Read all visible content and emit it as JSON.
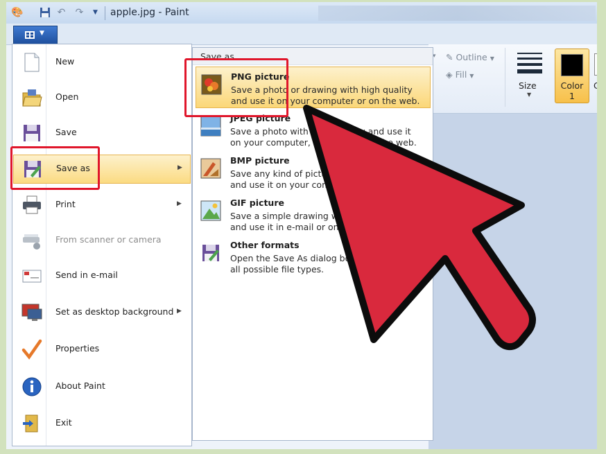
{
  "window": {
    "title": "apple.jpg - Paint"
  },
  "ribbon": {
    "outline_label": "Outline",
    "fill_label": "Fill",
    "size_label": "Size",
    "color1_label_line1": "Color",
    "color1_label_line2": "1",
    "color2_label_partial": "Co"
  },
  "app_menu": {
    "items": [
      {
        "label": "New",
        "icon": "new-page-icon"
      },
      {
        "label": "Open",
        "icon": "open-folder-icon"
      },
      {
        "label": "Save",
        "icon": "save-disk-icon"
      },
      {
        "label": "Save as",
        "icon": "save-as-icon",
        "highlighted": true,
        "submenu": true
      },
      {
        "label": "Print",
        "icon": "printer-icon",
        "submenu": true
      },
      {
        "label": "From scanner or camera",
        "icon": "scanner-icon",
        "disabled": true
      },
      {
        "label": "Send in e-mail",
        "icon": "email-icon"
      },
      {
        "label": "Set as desktop background",
        "icon": "desktop-background-icon",
        "submenu": true
      },
      {
        "label": "Properties",
        "icon": "checkmark-icon"
      },
      {
        "label": "About Paint",
        "icon": "info-icon"
      },
      {
        "label": "Exit",
        "icon": "exit-icon"
      }
    ]
  },
  "save_as_menu": {
    "heading": "Save as",
    "items": [
      {
        "title": "PNG picture",
        "line1": "Save a photo or drawing with high quality",
        "line2": "and use it on your computer or on the web.",
        "highlighted": true
      },
      {
        "title": "JPEG picture",
        "line1": "Save a photo with good quality and use it",
        "line2": "on your computer, in e-mail or on the web."
      },
      {
        "title": "BMP picture",
        "line1": "Save any kind of picture with high quality",
        "line2": "and use it on your computer."
      },
      {
        "title": "GIF picture",
        "line1": "Save a simple drawing with lower quality",
        "line2": "and use it in e-mail or on the web."
      },
      {
        "title": "Other formats",
        "line1": "Open the Save As dialog box to select from",
        "line2": "all possible file types."
      }
    ]
  },
  "colors": {
    "highlight": "#fbdb82",
    "annotation_red": "#e0162b",
    "arrow_fill": "#d9293d",
    "frame": "#d2e2bd"
  }
}
